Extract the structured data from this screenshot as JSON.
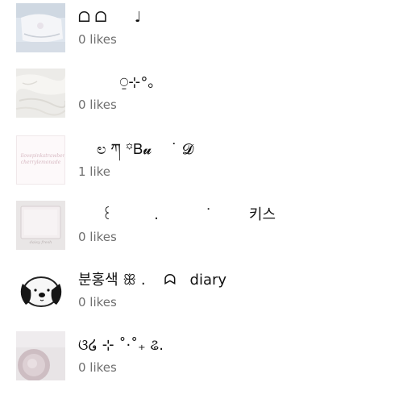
{
  "items": [
    {
      "title": "ᗝ ᗝ      ♩",
      "likes": "0 likes",
      "thumb": "white-pillow-photo-icon"
    },
    {
      "title": "         ⍜⊹°｡",
      "likes": "0 likes",
      "thumb": "white-fabric-photo-icon"
    },
    {
      "title": "    ಲ ཀ ꙳Ᏼ𝓾    ˙ 𝓓",
      "likes": "1 like",
      "thumb": "text-card-image-icon"
    },
    {
      "title": "     ꒰         .          ˙        키스",
      "likes": "0 likes",
      "thumb": "pink-tray-photo-icon"
    },
    {
      "title": "분홍색 ꕥ .    ᗣ   diary",
      "likes": "0 likes",
      "thumb": "puppy-character-icon"
    },
    {
      "title": "ଓ໒ ⊹ ˚·˚₊ ଌ.",
      "likes": "0 likes",
      "thumb": "latte-cup-photo-icon"
    }
  ],
  "thumb_text": "ilovepinkstrawberry cherrylemonade",
  "tray_caption": "daisy fresh"
}
